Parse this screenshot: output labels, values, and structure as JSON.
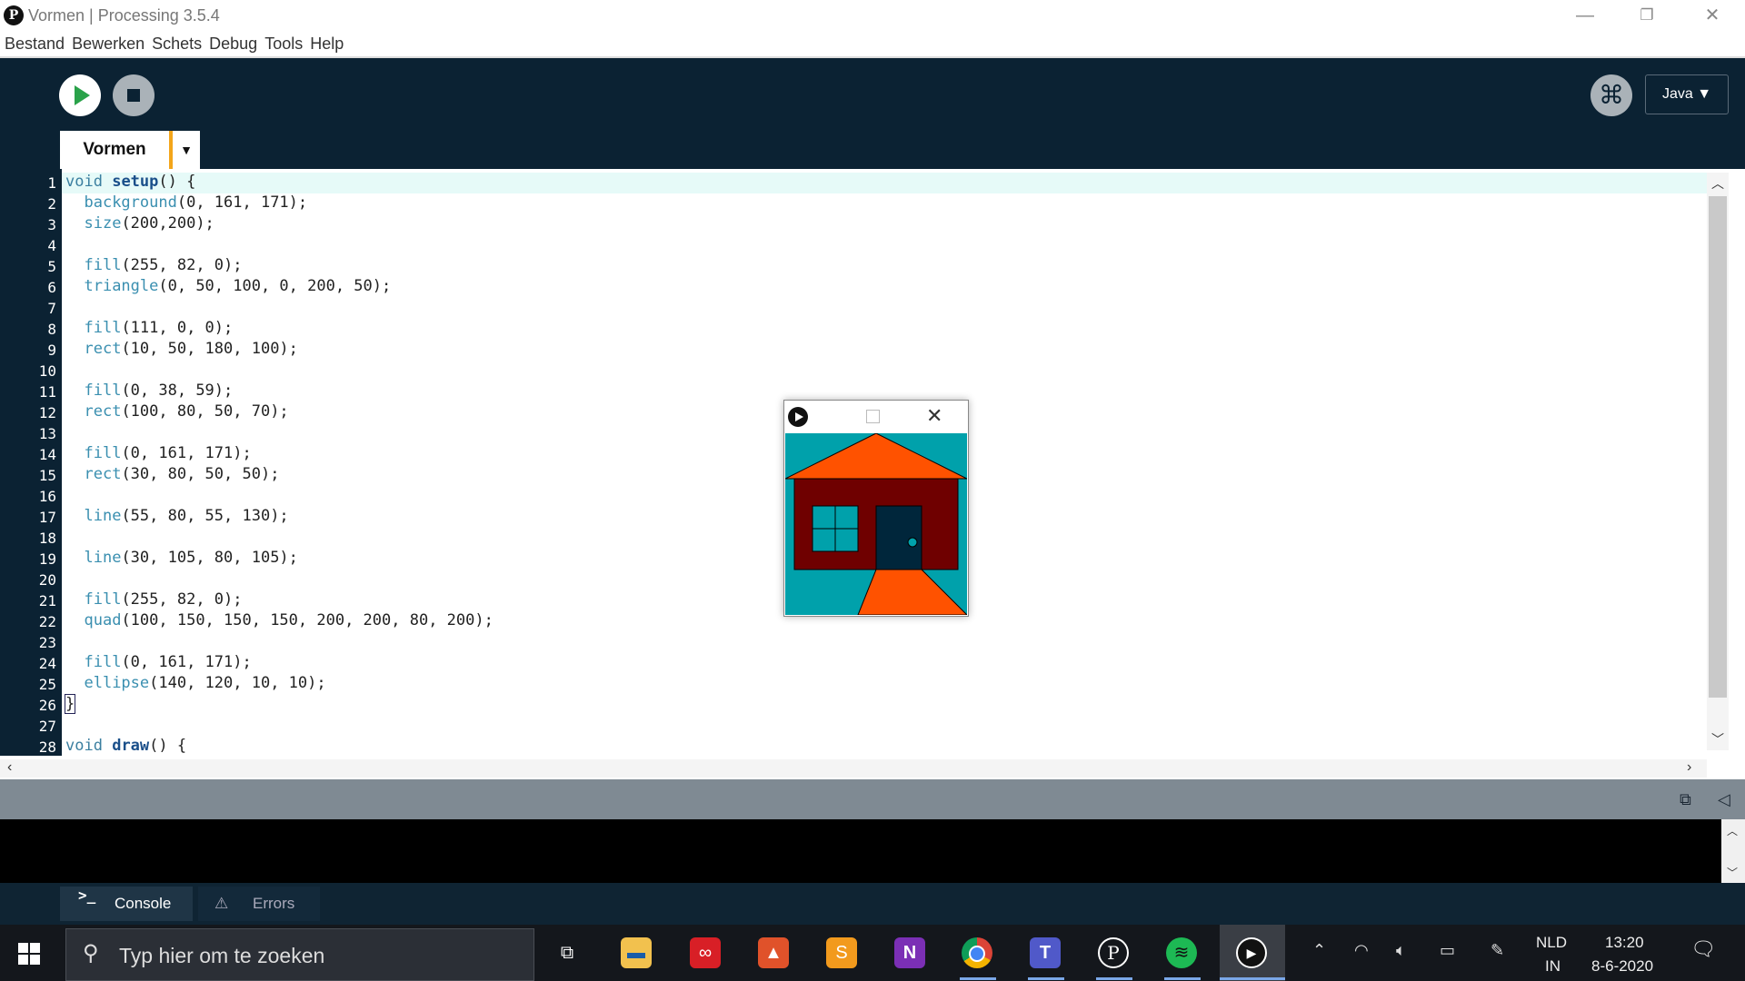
{
  "window": {
    "title": "Vormen | Processing 3.5.4",
    "logo": "P"
  },
  "menu": [
    "Bestand",
    "Bewerken",
    "Schets",
    "Debug",
    "Tools",
    "Help"
  ],
  "toolbar": {
    "mode_label": "Java ▼",
    "tab_label": "Vormen",
    "tab_menu": "▼"
  },
  "editor": {
    "line_numbers": [
      "1",
      "2",
      "3",
      "4",
      "5",
      "6",
      "7",
      "8",
      "9",
      "10",
      "11",
      "12",
      "13",
      "14",
      "15",
      "16",
      "17",
      "18",
      "19",
      "20",
      "21",
      "22",
      "23",
      "24",
      "25",
      "26",
      "27",
      "28"
    ],
    "lines": [
      "void setup() {",
      "  background(0, 161, 171);",
      "  size(200,200);",
      "",
      "  fill(255, 82, 0);",
      "  triangle(0, 50, 100, 0, 200, 50);",
      "",
      "  fill(111, 0, 0);",
      "  rect(10, 50, 180, 100);",
      "",
      "  fill(0, 38, 59);",
      "  rect(100, 80, 50, 70);",
      "",
      "  fill(0, 161, 171);",
      "  rect(30, 80, 50, 50);",
      "",
      "  line(55, 80, 55, 130);",
      "",
      "  line(30, 105, 80, 105);",
      "",
      "  fill(255, 82, 0);",
      "  quad(100, 150, 150, 150, 200, 200, 80, 200);",
      "",
      "  fill(0, 161, 171);",
      "  ellipse(140, 120, 10, 10);",
      "}",
      "",
      "void draw() {"
    ]
  },
  "console_tabs": {
    "console": "Console",
    "errors": "Errors"
  },
  "taskbar": {
    "search_placeholder": "Typ hier om te zoeken",
    "lang_top": "NLD",
    "lang_bottom": "IN",
    "time": "13:20",
    "date": "8-6-2020"
  },
  "colors": {
    "toolbar": "#0b2233",
    "run": "#2aa24a",
    "tab_accent": "#f3a51a",
    "sky": "#00a1ab",
    "roof": "#ff5200",
    "wall": "#6f0000",
    "door": "#00263b"
  }
}
